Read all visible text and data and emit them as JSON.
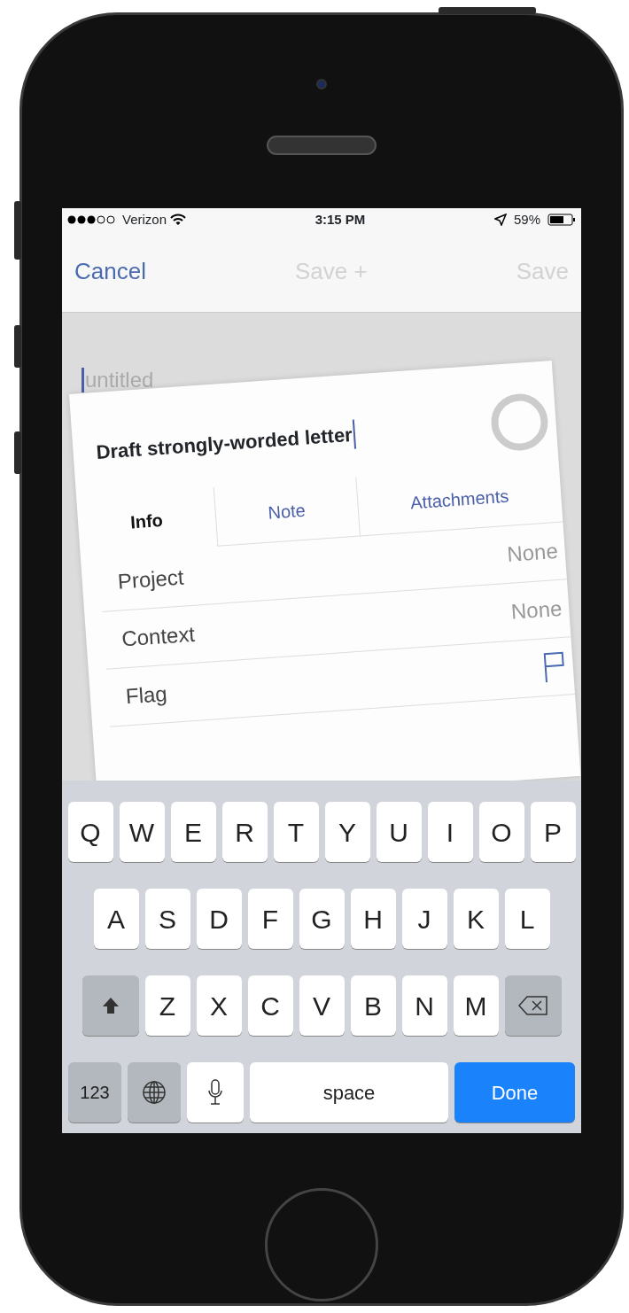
{
  "status_bar": {
    "carrier": "Verizon",
    "time": "3:15 PM",
    "battery": "59%"
  },
  "nav": {
    "buttons": [
      {
        "label": "Cancel",
        "disabled": false
      },
      {
        "label": "Save +",
        "disabled": true
      },
      {
        "label": "Save",
        "disabled": true
      }
    ]
  },
  "background_title": {
    "placeholder": "untitled"
  },
  "task": {
    "title": "Draft strongly-worded letter",
    "completed": false,
    "tabs": [
      {
        "label": "Info",
        "selected": true
      },
      {
        "label": "Note",
        "selected": false
      },
      {
        "label": "Attachments",
        "selected": false
      }
    ],
    "rows": [
      {
        "kind": "value",
        "label": "Project",
        "value": "None"
      },
      {
        "kind": "value",
        "label": "Context",
        "value": "None"
      },
      {
        "kind": "flag",
        "label": "Flag",
        "flagged": false
      }
    ]
  },
  "keyboard": {
    "letter_rows": [
      [
        {
          "kind": "letter",
          "label": "Q"
        },
        {
          "kind": "letter",
          "label": "W"
        },
        {
          "kind": "letter",
          "label": "E"
        },
        {
          "kind": "letter",
          "label": "R"
        },
        {
          "kind": "letter",
          "label": "T"
        },
        {
          "kind": "letter",
          "label": "Y"
        },
        {
          "kind": "letter",
          "label": "U"
        },
        {
          "kind": "letter",
          "label": "I"
        },
        {
          "kind": "letter",
          "label": "O"
        },
        {
          "kind": "letter",
          "label": "P"
        }
      ],
      [
        {
          "kind": "letter",
          "label": "A"
        },
        {
          "kind": "letter",
          "label": "S"
        },
        {
          "kind": "letter",
          "label": "D"
        },
        {
          "kind": "letter",
          "label": "F"
        },
        {
          "kind": "letter",
          "label": "G"
        },
        {
          "kind": "letter",
          "label": "H"
        },
        {
          "kind": "letter",
          "label": "J"
        },
        {
          "kind": "letter",
          "label": "K"
        },
        {
          "kind": "letter",
          "label": "L"
        }
      ],
      [
        {
          "kind": "shift"
        },
        {
          "kind": "letter",
          "label": "Z"
        },
        {
          "kind": "letter",
          "label": "X"
        },
        {
          "kind": "letter",
          "label": "C"
        },
        {
          "kind": "letter",
          "label": "V"
        },
        {
          "kind": "letter",
          "label": "B"
        },
        {
          "kind": "letter",
          "label": "N"
        },
        {
          "kind": "letter",
          "label": "M"
        },
        {
          "kind": "delete"
        }
      ]
    ],
    "bottom_keys": [
      {
        "kind": "mode",
        "label": "123"
      },
      {
        "kind": "globe"
      },
      {
        "kind": "mic"
      },
      {
        "kind": "space",
        "label": "space"
      },
      {
        "kind": "done",
        "label": "Done"
      }
    ]
  }
}
